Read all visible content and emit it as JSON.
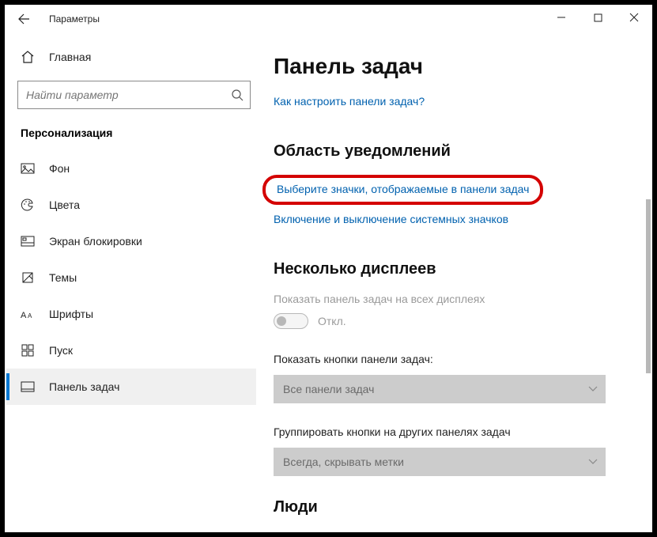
{
  "window": {
    "title": "Параметры"
  },
  "sidebar": {
    "home_label": "Главная",
    "search_placeholder": "Найти параметр",
    "category": "Персонализация",
    "items": [
      {
        "label": "Фон"
      },
      {
        "label": "Цвета"
      },
      {
        "label": "Экран блокировки"
      },
      {
        "label": "Темы"
      },
      {
        "label": "Шрифты"
      },
      {
        "label": "Пуск"
      },
      {
        "label": "Панель задач"
      }
    ]
  },
  "page": {
    "title": "Панель задач",
    "help_link": "Как настроить панели задач?",
    "notification_area": {
      "heading": "Область уведомлений",
      "select_icons": "Выберите значки, отображаемые в панели задач",
      "system_icons": "Включение и выключение системных значков"
    },
    "multi_display": {
      "heading": "Несколько дисплеев",
      "show_on_all": "Показать панель задач на всех дисплеях",
      "toggle_state": "Откл.",
      "show_buttons_label": "Показать кнопки панели задач:",
      "show_buttons_value": "Все панели задач",
      "group_label": "Группировать кнопки на других панелях задач",
      "group_value": "Всегда, скрывать метки"
    },
    "people": {
      "heading": "Люди"
    }
  }
}
